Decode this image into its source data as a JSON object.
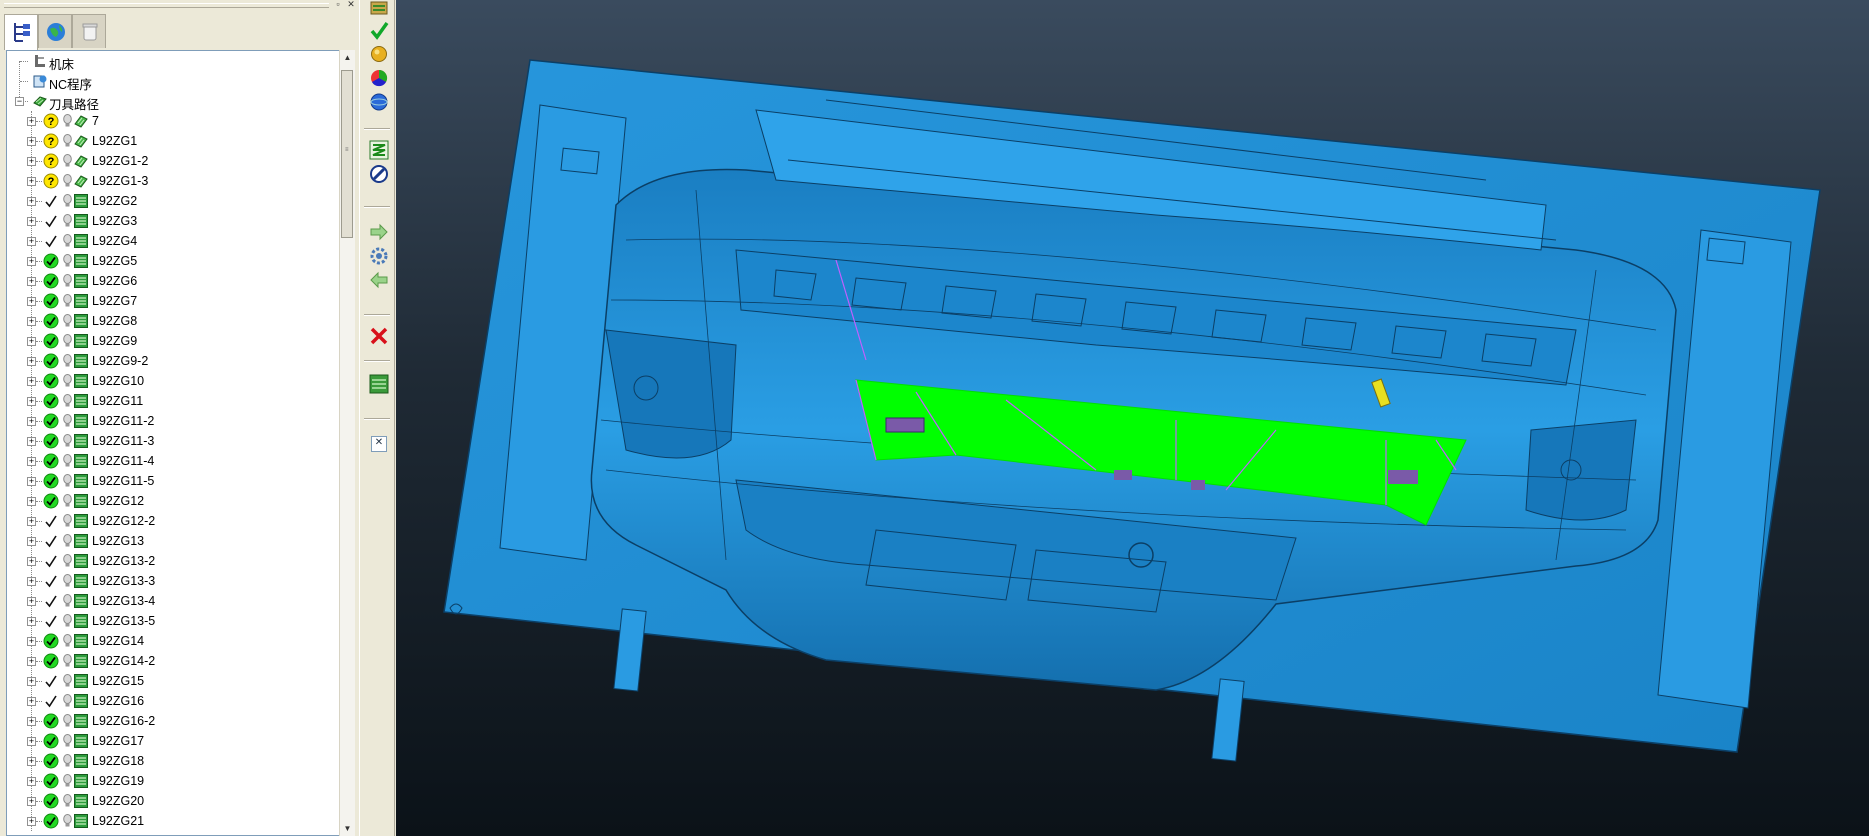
{
  "window": {
    "restore_glyph": "▫",
    "close_glyph": "✕"
  },
  "panel_tabs": [
    {
      "icon": "explorer-tree-icon",
      "active": true
    },
    {
      "icon": "globe-icon",
      "active": false
    },
    {
      "icon": "recycle-bin-icon",
      "active": false
    }
  ],
  "tree": {
    "roots": [
      {
        "label": "机床",
        "icon": "machine-icon"
      },
      {
        "label": "NC程序",
        "icon": "nc-program-icon"
      },
      {
        "label": "刀具路径",
        "icon": "toolpath-folder-icon",
        "expanded": true
      }
    ],
    "toolpaths": [
      {
        "name": "7",
        "status": "unknown"
      },
      {
        "name": "L92ZG1",
        "status": "unknown"
      },
      {
        "name": "L92ZG1-2",
        "status": "unknown"
      },
      {
        "name": "L92ZG1-3",
        "status": "unknown"
      },
      {
        "name": "L92ZG2",
        "status": "check"
      },
      {
        "name": "L92ZG3",
        "status": "check"
      },
      {
        "name": "L92ZG4",
        "status": "check"
      },
      {
        "name": "L92ZG5",
        "status": "done"
      },
      {
        "name": "L92ZG6",
        "status": "done"
      },
      {
        "name": "L92ZG7",
        "status": "done"
      },
      {
        "name": "L92ZG8",
        "status": "done"
      },
      {
        "name": "L92ZG9",
        "status": "done"
      },
      {
        "name": "L92ZG9-2",
        "status": "done"
      },
      {
        "name": "L92ZG10",
        "status": "done"
      },
      {
        "name": "L92ZG11",
        "status": "done"
      },
      {
        "name": "L92ZG11-2",
        "status": "done"
      },
      {
        "name": "L92ZG11-3",
        "status": "done"
      },
      {
        "name": "L92ZG11-4",
        "status": "done"
      },
      {
        "name": "L92ZG11-5",
        "status": "done"
      },
      {
        "name": "L92ZG12",
        "status": "done"
      },
      {
        "name": "L92ZG12-2",
        "status": "check"
      },
      {
        "name": "L92ZG13",
        "status": "check"
      },
      {
        "name": "L92ZG13-2",
        "status": "check"
      },
      {
        "name": "L92ZG13-3",
        "status": "check"
      },
      {
        "name": "L92ZG13-4",
        "status": "check"
      },
      {
        "name": "L92ZG13-5",
        "status": "check"
      },
      {
        "name": "L92ZG14",
        "status": "done"
      },
      {
        "name": "L92ZG14-2",
        "status": "done"
      },
      {
        "name": "L92ZG15",
        "status": "check"
      },
      {
        "name": "L92ZG16",
        "status": "check"
      },
      {
        "name": "L92ZG16-2",
        "status": "done"
      },
      {
        "name": "L92ZG17",
        "status": "done"
      },
      {
        "name": "L92ZG18",
        "status": "done"
      },
      {
        "name": "L92ZG19",
        "status": "done"
      },
      {
        "name": "L92ZG20",
        "status": "done"
      },
      {
        "name": "L92ZG21",
        "status": "done"
      }
    ]
  },
  "toolbar": {
    "buttons": [
      {
        "icon": "calculate-toolpath-icon"
      },
      {
        "icon": "verify-check-icon"
      },
      {
        "icon": "yellow-sphere-icon"
      },
      {
        "icon": "color-wheel-icon"
      },
      {
        "icon": "blue-globe-icon"
      },
      {
        "icon": "zigzag-toolpath-icon"
      },
      {
        "icon": "edit-toolpath-icon"
      },
      {
        "icon": "arrow-right-icon"
      },
      {
        "icon": "settings-gear-icon"
      },
      {
        "icon": "arrow-left-icon"
      },
      {
        "icon": "delete-x-icon"
      },
      {
        "icon": "toolpath-list-icon"
      },
      {
        "icon": "close-panel-icon"
      }
    ],
    "close_glyph": "✕"
  },
  "viewport": {
    "model_color": "#1e8fd6",
    "toolpath_color": "#00ff00",
    "background_top": "#3a4b5e",
    "background_bottom": "#0b1218"
  }
}
